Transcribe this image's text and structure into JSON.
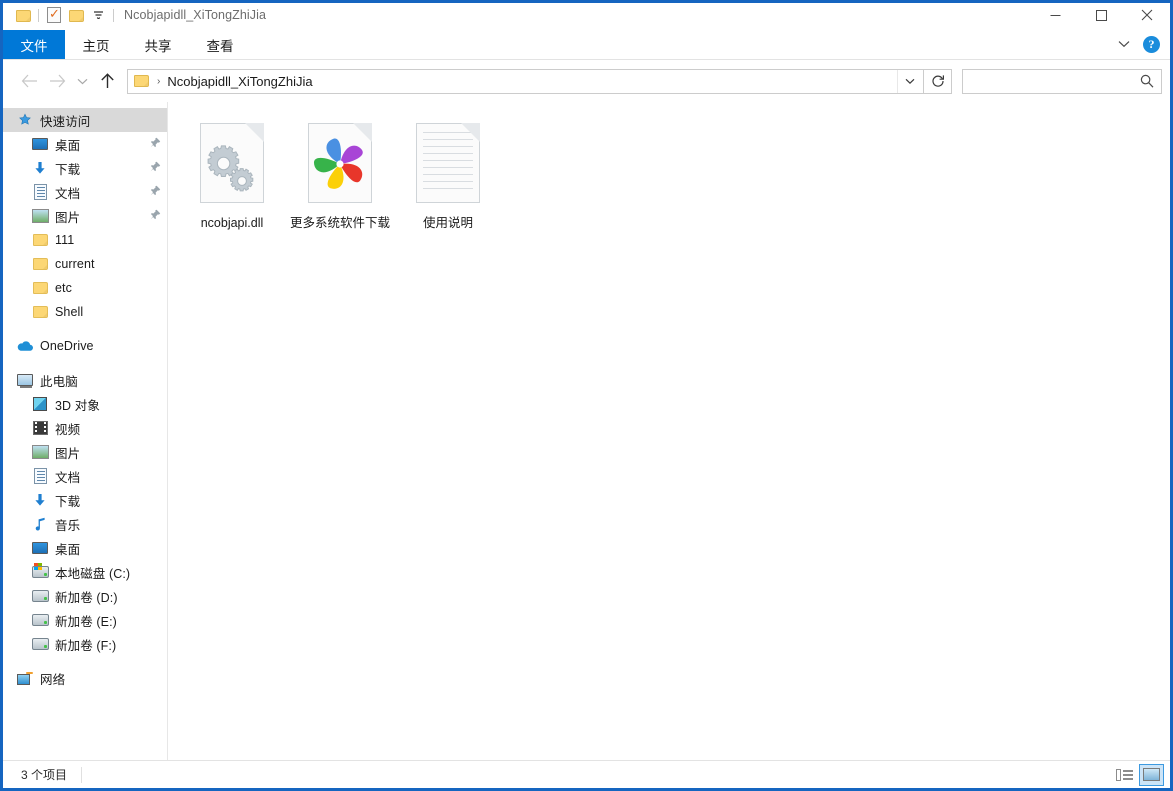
{
  "window": {
    "title": "Ncobjapidll_XiTongZhiJia",
    "quick_access_toolbar": [
      {
        "name": "folder-icon",
        "label": "属性"
      },
      {
        "name": "properties-icon",
        "label": "属性"
      },
      {
        "name": "new-folder-icon",
        "label": "新建文件夹"
      },
      {
        "name": "chevron-down-icon",
        "label": "自定义快速访问工具栏"
      }
    ],
    "controls": {
      "minimize": "—",
      "maximize": "☐",
      "close": "✕"
    },
    "accent_color": "#0078d7",
    "frame_color": "#1565c0"
  },
  "ribbon": {
    "tabs": [
      {
        "label": "文件",
        "active": true
      },
      {
        "label": "主页",
        "active": false
      },
      {
        "label": "共享",
        "active": false
      },
      {
        "label": "查看",
        "active": false
      }
    ],
    "collapse_label": "⌄",
    "help_label": "?"
  },
  "navbar": {
    "back_label": "←",
    "forward_label": "→",
    "recent_label": "⌄",
    "up_label": "↑",
    "breadcrumb": {
      "separator": "›",
      "path": "Ncobjapidll_XiTongZhiJia"
    },
    "address_dropdown_label": "⌄",
    "refresh_label": "↻",
    "search": {
      "value": "",
      "placeholder": ""
    }
  },
  "sidebar": {
    "groups": [
      {
        "header": {
          "label": "快速访问",
          "icon": "star-pin-icon",
          "selected": true,
          "level": 0
        },
        "items": [
          {
            "label": "桌面",
            "icon": "desktop-icon",
            "pinned": true,
            "level": 1
          },
          {
            "label": "下载",
            "icon": "downloads-icon",
            "pinned": true,
            "level": 1
          },
          {
            "label": "文档",
            "icon": "documents-icon",
            "pinned": true,
            "level": 1
          },
          {
            "label": "图片",
            "icon": "pictures-icon",
            "pinned": true,
            "level": 1
          },
          {
            "label": "111",
            "icon": "folder-icon",
            "pinned": false,
            "level": 1
          },
          {
            "label": "current",
            "icon": "folder-icon",
            "pinned": false,
            "level": 1
          },
          {
            "label": "etc",
            "icon": "folder-icon",
            "pinned": false,
            "level": 1
          },
          {
            "label": "Shell",
            "icon": "folder-icon",
            "pinned": false,
            "level": 1
          }
        ]
      },
      {
        "header": {
          "label": "OneDrive",
          "icon": "cloud-icon",
          "selected": false,
          "level": 0
        },
        "items": []
      },
      {
        "header": {
          "label": "此电脑",
          "icon": "this-pc-icon",
          "selected": false,
          "level": 0
        },
        "items": [
          {
            "label": "3D 对象",
            "icon": "3d-objects-icon",
            "pinned": false,
            "level": 1
          },
          {
            "label": "视频",
            "icon": "videos-icon",
            "pinned": false,
            "level": 1
          },
          {
            "label": "图片",
            "icon": "pictures-icon",
            "pinned": false,
            "level": 1
          },
          {
            "label": "文档",
            "icon": "documents-icon",
            "pinned": false,
            "level": 1
          },
          {
            "label": "下载",
            "icon": "downloads-icon",
            "pinned": false,
            "level": 1
          },
          {
            "label": "音乐",
            "icon": "music-icon",
            "pinned": false,
            "level": 1
          },
          {
            "label": "桌面",
            "icon": "desktop-icon",
            "pinned": false,
            "level": 1
          },
          {
            "label": "本地磁盘 (C:)",
            "icon": "system-drive-icon",
            "pinned": false,
            "level": 1
          },
          {
            "label": "新加卷 (D:)",
            "icon": "drive-icon",
            "pinned": false,
            "level": 1
          },
          {
            "label": "新加卷 (E:)",
            "icon": "drive-icon",
            "pinned": false,
            "level": 1
          },
          {
            "label": "新加卷 (F:)",
            "icon": "drive-icon",
            "pinned": false,
            "level": 1
          }
        ]
      },
      {
        "header": {
          "label": "网络",
          "icon": "network-icon",
          "selected": false,
          "level": 0
        },
        "items": []
      }
    ],
    "pin_glyph": "📌"
  },
  "files": [
    {
      "name": "ncobjapi.dll",
      "icon": "dll-gears-icon"
    },
    {
      "name": "更多系统软件下载",
      "icon": "pinwheel-browser-icon"
    },
    {
      "name": "使用说明",
      "icon": "text-document-icon"
    }
  ],
  "statusbar": {
    "item_count": "3 个项目",
    "views": [
      {
        "name": "details-view-button",
        "active": false
      },
      {
        "name": "large-icons-view-button",
        "active": true
      }
    ]
  }
}
